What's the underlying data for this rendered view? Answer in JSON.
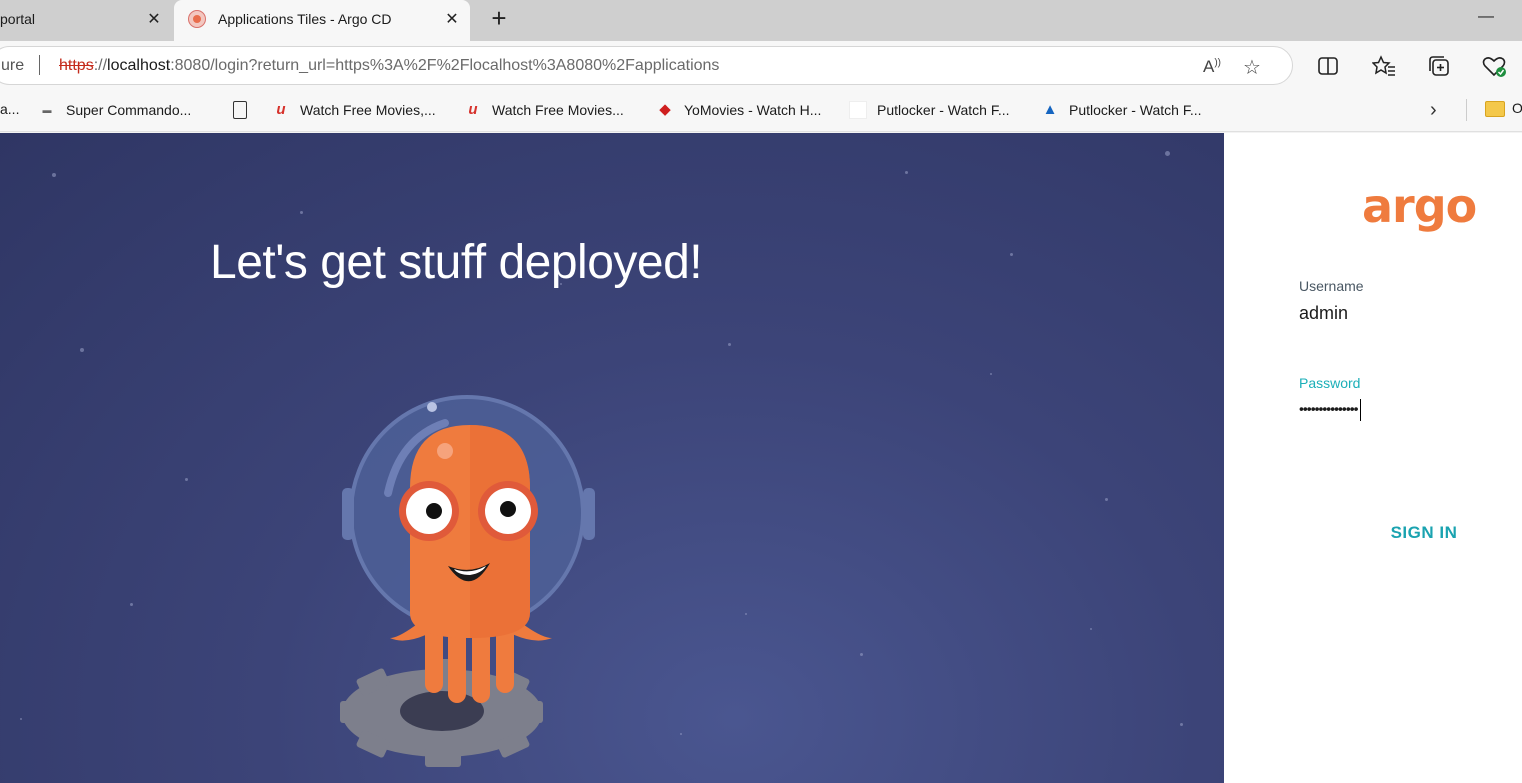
{
  "browser": {
    "tabs": [
      {
        "title": "portal",
        "active": false
      },
      {
        "title": "Applications Tiles - Argo CD",
        "active": true
      }
    ],
    "close_glyph": "✕",
    "new_tab_glyph": "+",
    "minimize_glyph": "—",
    "address": {
      "security_text": "ure",
      "url_scheme": "https",
      "url_separator": "://",
      "url_host": "localhost",
      "url_rest": ":8080/login?return_url=https%3A%2F%2Flocalhost%3A8080%2Fapplications"
    },
    "toolbar_icons": [
      "split-screen-icon",
      "favorites-icon",
      "collections-icon",
      "browser-essentials-icon"
    ],
    "bookmarks": [
      {
        "label": "a...",
        "icon": "none"
      },
      {
        "label": "Super Commando...",
        "icon": "site-icon"
      },
      {
        "label": "",
        "icon": "document-icon"
      },
      {
        "label": "Watch Free Movies,...",
        "icon": "u-icon"
      },
      {
        "label": "Watch Free Movies...",
        "icon": "u-icon"
      },
      {
        "label": "YoMovies - Watch H...",
        "icon": "diamond-icon"
      },
      {
        "label": "Putlocker - Watch F...",
        "icon": "blank-icon"
      },
      {
        "label": "Putlocker - Watch F...",
        "icon": "azure-icon"
      }
    ],
    "bookmarks_overflow_label": "O"
  },
  "page": {
    "hero_title": "Let's get stuff deployed!",
    "logo_text": "argo",
    "brand_color": "#ef7b3e",
    "accent_color": "#1aa3b0",
    "username_label": "Username",
    "username_value": "admin",
    "password_label": "Password",
    "password_value": "•••••••••••••••",
    "sign_in_label": "SIGN IN"
  }
}
